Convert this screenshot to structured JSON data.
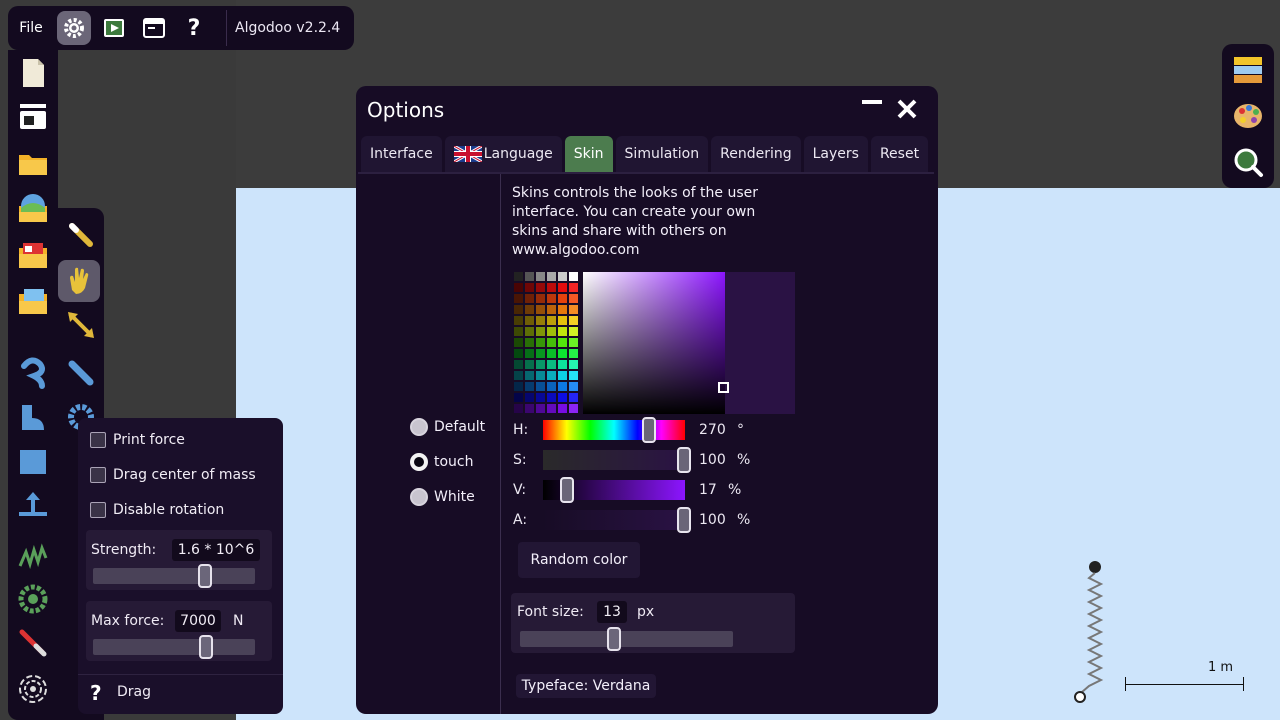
{
  "app": {
    "file_menu": "File",
    "version": "Algodoo v2.2.4"
  },
  "drag_panel": {
    "print_force": "Print force",
    "drag_center_of_mass": "Drag center of mass",
    "disable_rotation": "Disable rotation",
    "strength_label": "Strength:",
    "strength_value": "1.6 * 10^6",
    "max_force_label": "Max force:",
    "max_force_value": "7000",
    "max_force_unit": "N",
    "tool_name": "Drag",
    "strength_slider": 0.69,
    "max_force_slider": 0.7
  },
  "options": {
    "title": "Options",
    "tabs": [
      {
        "label": "Interface"
      },
      {
        "label": "Language"
      },
      {
        "label": "Skin"
      },
      {
        "label": "Simulation"
      },
      {
        "label": "Rendering"
      },
      {
        "label": "Layers"
      },
      {
        "label": "Reset"
      }
    ],
    "active_tab": "Skin",
    "description": "Skins controls the looks of the user interface. You can create your own skins and share with others on www.algodoo.com",
    "skins": [
      {
        "label": "Default",
        "selected": false
      },
      {
        "label": "touch",
        "selected": true
      },
      {
        "label": "White",
        "selected": false
      }
    ],
    "color": {
      "h_label": "H:",
      "h_value": "270",
      "h_unit": "°",
      "s_label": "S:",
      "s_value": "100",
      "s_unit": "%",
      "v_label": "V:",
      "v_value": "17",
      "v_unit": "%",
      "a_label": "A:",
      "a_value": "100",
      "a_unit": "%"
    },
    "random_color": "Random color",
    "font_size_label": "Font size:",
    "font_size_value": "13",
    "font_size_unit": "px",
    "typeface": "Typeface: Verdana",
    "font_size_slider": 0.44
  },
  "scene": {
    "scale_label": "1 m"
  },
  "colors": {
    "accent": "#4c7c4e",
    "panel": "#170c25",
    "sky": "#cde4fb"
  }
}
